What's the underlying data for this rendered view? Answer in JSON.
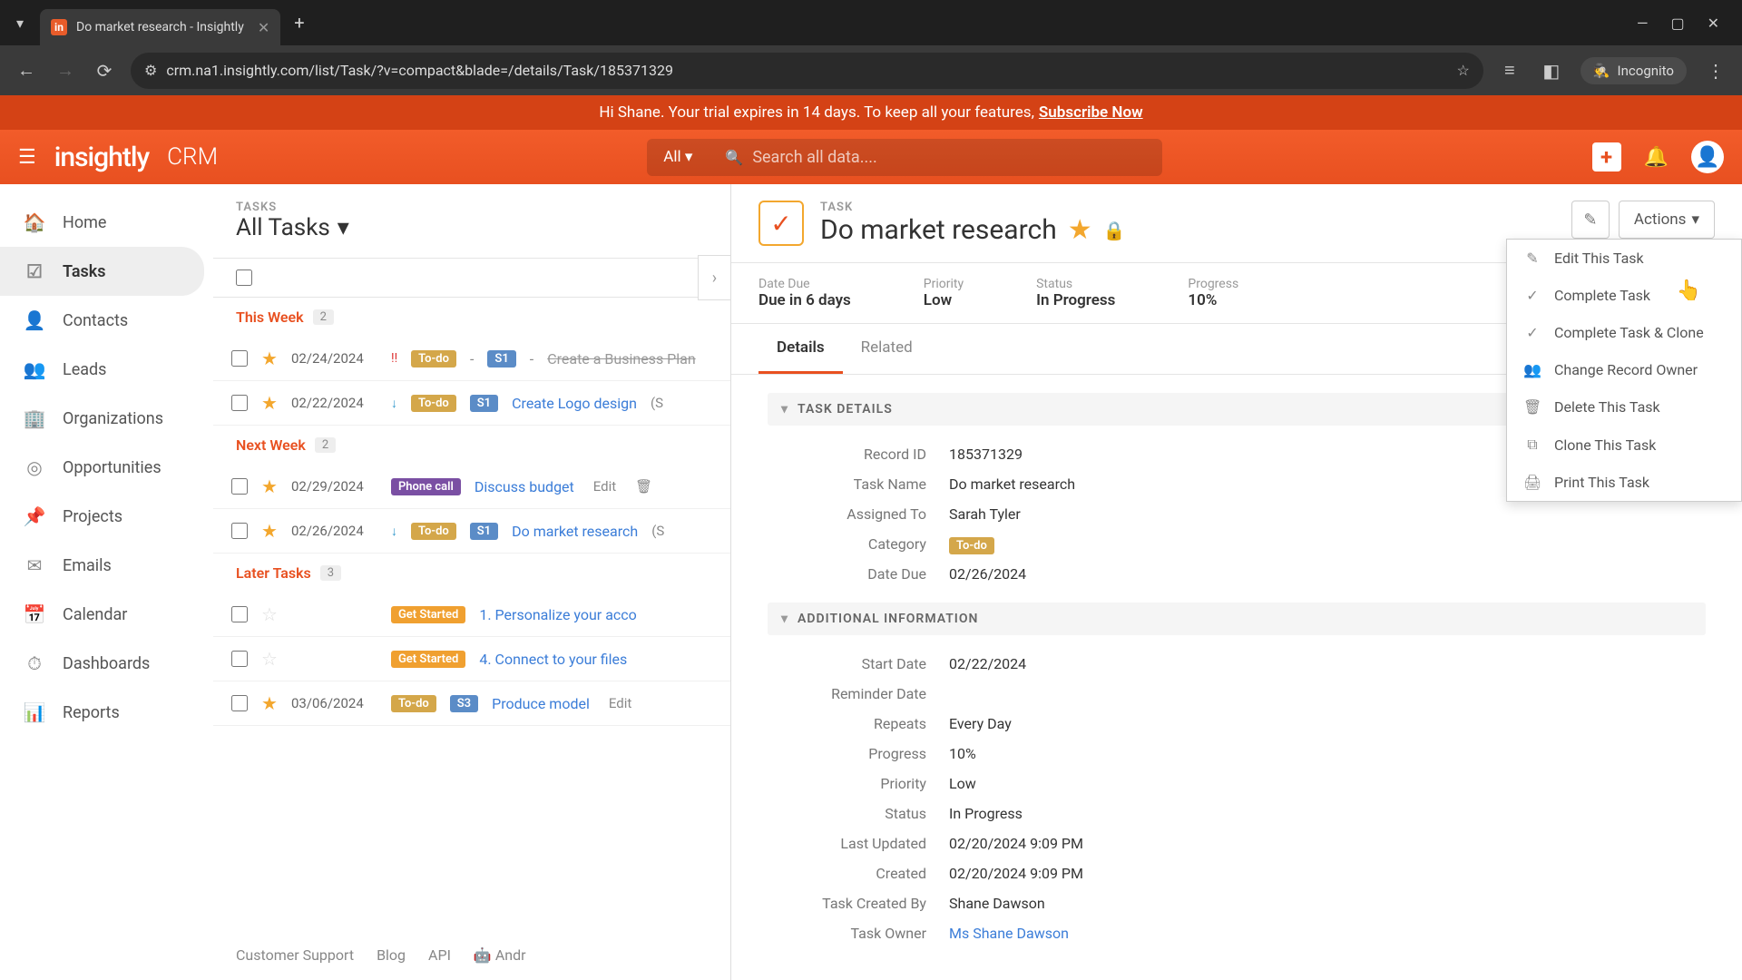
{
  "browser": {
    "tab_title": "Do market research - Insightly",
    "url": "crm.na1.insightly.com/list/Task/?v=compact&blade=/details/Task/185371329",
    "incognito_label": "Incognito"
  },
  "trial": {
    "prefix": "Hi Shane. Your trial expires in 14 days. To keep all your features, ",
    "link": "Subscribe Now"
  },
  "header": {
    "logo": "insightly",
    "crm": "CRM",
    "search_scope": "All ▾",
    "search_placeholder": "Search all data...."
  },
  "sidebar": {
    "items": [
      {
        "label": "Home"
      },
      {
        "label": "Tasks"
      },
      {
        "label": "Contacts"
      },
      {
        "label": "Leads"
      },
      {
        "label": "Organizations"
      },
      {
        "label": "Opportunities"
      },
      {
        "label": "Projects"
      },
      {
        "label": "Emails"
      },
      {
        "label": "Calendar"
      },
      {
        "label": "Dashboards"
      },
      {
        "label": "Reports"
      }
    ]
  },
  "tasklist": {
    "subtitle": "TASKS",
    "title": "All Tasks",
    "groups": {
      "this_week": {
        "label": "This Week",
        "count": "2"
      },
      "next_week": {
        "label": "Next Week",
        "count": "2"
      },
      "later": {
        "label": "Later Tasks",
        "count": "3"
      }
    },
    "rows": {
      "r1": {
        "date": "02/24/2024",
        "title": "Create a Business Plan"
      },
      "r2": {
        "date": "02/22/2024",
        "title": "Create Logo design",
        "suffix": "(S"
      },
      "r3": {
        "date": "02/29/2024",
        "title": "Discuss budget",
        "edit": "Edit"
      },
      "r4": {
        "date": "02/26/2024",
        "title": "Do market research",
        "suffix": "(S"
      },
      "r5": {
        "title": "1. Personalize your acco"
      },
      "r6": {
        "title": "4. Connect to your files"
      },
      "r7": {
        "date": "03/06/2024",
        "title": "Produce model",
        "edit": "Edit"
      }
    },
    "badges": {
      "todo": "To-do",
      "s1": "S1",
      "s3": "S3",
      "phone": "Phone call",
      "getstarted": "Get Started"
    }
  },
  "footer": {
    "support": "Customer Support",
    "blog": "Blog",
    "api": "API",
    "android": "Andr"
  },
  "detail": {
    "subtitle": "TASK",
    "title": "Do market research",
    "actions_label": "Actions",
    "summary": {
      "due_label": "Date Due",
      "due_value": "Due in 6 days",
      "priority_label": "Priority",
      "priority_value": "Low",
      "status_label": "Status",
      "status_value": "In Progress",
      "progress_label": "Progress",
      "progress_value": "10%"
    },
    "tabs": {
      "details": "Details",
      "related": "Related"
    },
    "sections": {
      "task_details": "TASK DETAILS",
      "additional": "ADDITIONAL INFORMATION"
    },
    "fields": {
      "record_id": {
        "label": "Record ID",
        "value": "185371329"
      },
      "task_name": {
        "label": "Task Name",
        "value": "Do market research"
      },
      "assigned_to": {
        "label": "Assigned To",
        "value": "Sarah Tyler"
      },
      "category": {
        "label": "Category",
        "value": "To-do"
      },
      "date_due": {
        "label": "Date Due",
        "value": "02/26/2024"
      },
      "start_date": {
        "label": "Start Date",
        "value": "02/22/2024"
      },
      "reminder_date": {
        "label": "Reminder Date",
        "value": ""
      },
      "repeats": {
        "label": "Repeats",
        "value": "Every Day"
      },
      "progress": {
        "label": "Progress",
        "value": "10%"
      },
      "priority": {
        "label": "Priority",
        "value": "Low"
      },
      "status": {
        "label": "Status",
        "value": "In Progress"
      },
      "last_updated": {
        "label": "Last Updated",
        "value": "02/20/2024 9:09 PM"
      },
      "created": {
        "label": "Created",
        "value": "02/20/2024 9:09 PM"
      },
      "task_created_by": {
        "label": "Task Created By",
        "value": "Shane Dawson"
      },
      "task_owner": {
        "label": "Task Owner",
        "value": "Ms Shane Dawson"
      }
    }
  },
  "dropdown": {
    "edit": "Edit This Task",
    "complete": "Complete Task",
    "complete_clone": "Complete Task & Clone",
    "change_owner": "Change Record Owner",
    "delete": "Delete This Task",
    "clone": "Clone This Task",
    "print": "Print This Task"
  }
}
